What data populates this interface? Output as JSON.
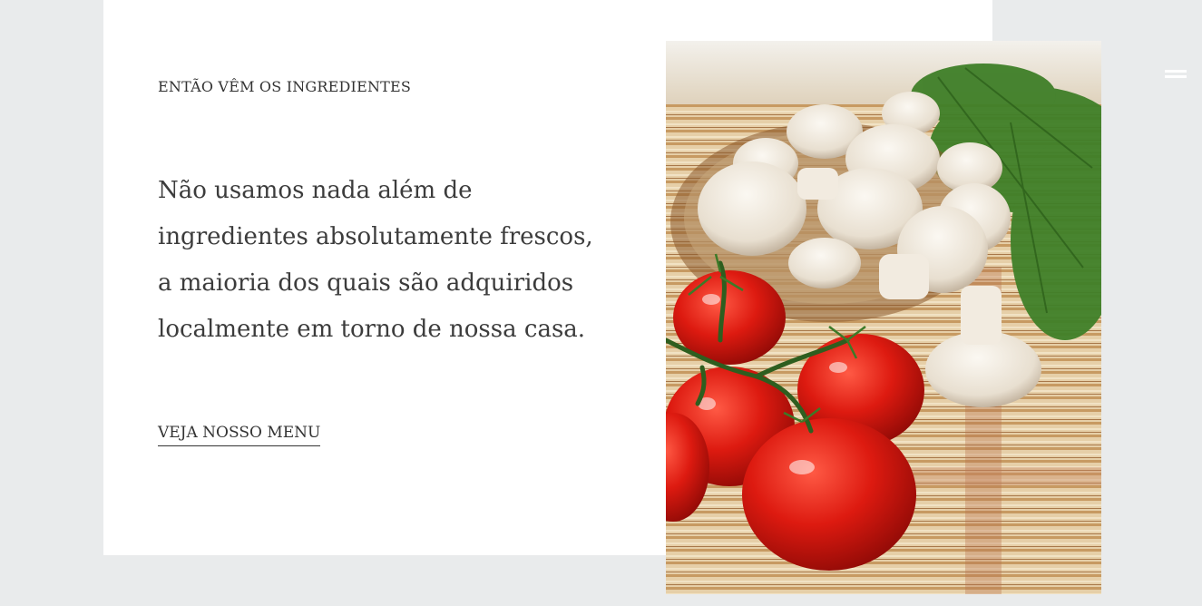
{
  "section": {
    "eyebrow": "ENTÃO VÊM OS INGREDIENTES",
    "lead_lines": [
      "Não usamos nada além de",
      "ingredientes absolutamente frescos,",
      "a maioria dos quais são adquiridos",
      "localmente em torno de nossa casa."
    ],
    "cta_label": "VEJA NOSSO MENU"
  },
  "header": {
    "menu_icon": "hamburger-menu-icon"
  },
  "image": {
    "subject": "tomatoes-mushrooms-dill-photo"
  },
  "colors": {
    "page_background": "#e9ebec",
    "card_background": "#ffffff",
    "text": "#333333",
    "tomato": "#d8160f",
    "mushroom": "#eee7dc",
    "dill": "#3d7a26"
  }
}
